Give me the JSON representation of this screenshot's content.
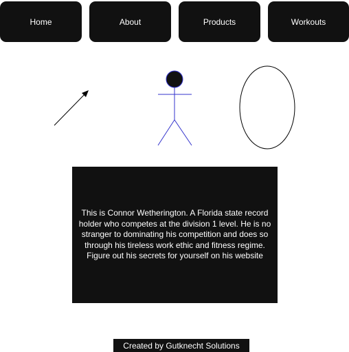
{
  "nav": {
    "items": [
      {
        "label": "Home"
      },
      {
        "label": "About"
      },
      {
        "label": "Products"
      },
      {
        "label": "Workouts"
      }
    ]
  },
  "drawings": {
    "arrow": {
      "icon": "arrow-icon",
      "color": "#000000"
    },
    "stick_figure": {
      "icon": "stick-figure-icon",
      "head_color": "#111111",
      "outline_color": "#3333cc"
    },
    "ellipse": {
      "icon": "ellipse-shape",
      "color": "#000000"
    }
  },
  "bio": {
    "text": "This is Connor Wetherington. A Florida state record holder who competes at the division 1 level. He is no stranger to dominating his competition and does so through his tireless work ethic and fitness regime. Figure out his secrets for yourself on his website"
  },
  "footer": {
    "text": "Created by Gutknecht Solutions"
  },
  "colors": {
    "dark_box": "#111111",
    "text_light": "#ffffff",
    "background": "#ffffff"
  }
}
